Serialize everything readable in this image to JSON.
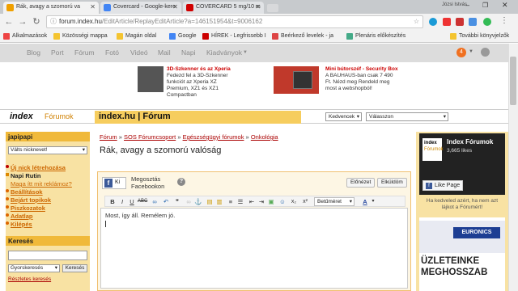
{
  "browser": {
    "tabs": [
      {
        "title": "Rák, avagy a szomorú va",
        "active": true,
        "favicon_color": "#f0a000"
      },
      {
        "title": "Covercard - Google-kere",
        "active": false,
        "favicon_color": "#4285f4"
      },
      {
        "title": "COVERCARD 5 mg/10 m",
        "active": false,
        "favicon_color": "#d00000"
      }
    ],
    "user_label": "Józsi Istvás",
    "url_host": "forum.index.hu",
    "url_path": "/EditArticle/ReplayEditArticle?a=146151954&t=9006162",
    "bookmarks": [
      {
        "label": "Alkalmazások",
        "color": "#e44"
      },
      {
        "label": "Közösségi mappa",
        "color": "#f4c430"
      },
      {
        "label": "Magán oldal",
        "color": "#f4c430"
      },
      {
        "label": "Google",
        "color": "#4285f4"
      },
      {
        "label": "HÍREK - Legfrissebb I",
        "color": "#c00"
      },
      {
        "label": "Beérkező levelek - ja",
        "color": "#d44"
      },
      {
        "label": "Plenáris előkészítés",
        "color": "#4a8"
      }
    ],
    "bookmarks_more": "További könyvjelzők"
  },
  "topnav": {
    "items": [
      "Blog",
      "Port",
      "Fórum",
      "Fotó",
      "Videó",
      "Mail",
      "Napi",
      "Kiadványok"
    ],
    "badge": "4"
  },
  "ads": [
    {
      "title": "3D-Szkenner és az Xperia",
      "body": [
        "Fedezd fel a 3D-Szkenner",
        "funkciót az Xperia XZ",
        "Premium, XZ1 és XZ1",
        "Compactban"
      ]
    },
    {
      "title": "Mini bútorszéf - Security Box",
      "body": [
        "A BAUHAUS-ban csak 7 490",
        "Ft. Nézd meg Rendeld meg",
        "most a webshopból!"
      ]
    }
  ],
  "header": {
    "logo_index": "index",
    "logo_forumok": "Fórumok",
    "site_title": "index.hu | Fórum",
    "select_favorites": "Kedvencek",
    "select_choose": "Válasszon"
  },
  "sidebar": {
    "user": "japipapi",
    "nick_select": "Válts nicknevet!",
    "links": [
      "Új nick létrehozása",
      "Napi Rutin",
      "Maga ítt mit reklámoz?",
      "Beállítások",
      "Bejárt topikok",
      "Piszkozatok",
      "Adatlap",
      "Kilépés"
    ],
    "search_title": "Keresés",
    "search_select": "Gyorskeresés",
    "search_button": "Keresés",
    "detailed_search": "Részletes keresés"
  },
  "main": {
    "breadcrumb": [
      "Fórum",
      "SOS Fórumcsoport",
      "Egészségügyi fórumok",
      "Onkológia"
    ],
    "breadcrumb_sep": "»",
    "title": "Rák, avagy a szomorú valóság",
    "fb_label": "Ki",
    "fb_text_1": "Megosztás",
    "fb_text_2": "Facebookon",
    "preview_button": "Előnézet",
    "send_button": "Elküldöm",
    "format_select": "Betűméret",
    "body_text": "Most, így áll. Remélem jó."
  },
  "right": {
    "fb_title": "Index Fórumok",
    "fb_likes": "3,665 likes",
    "fb_like_button": "Like Page",
    "fb_logo_1": "index",
    "fb_logo_2": "Fórumok",
    "hint_1": "Ha kedveled azért, ha nem azt",
    "hint_2": "lájkot a Fórumért!",
    "euronics": "EURONICS",
    "ad_1": "ÜZLETEINKE",
    "ad_2": "MEGHOSSZAB"
  },
  "colors": {
    "accent": "#f0b93a",
    "link": "#cc6600",
    "title_bg": "#f6cd5e"
  }
}
